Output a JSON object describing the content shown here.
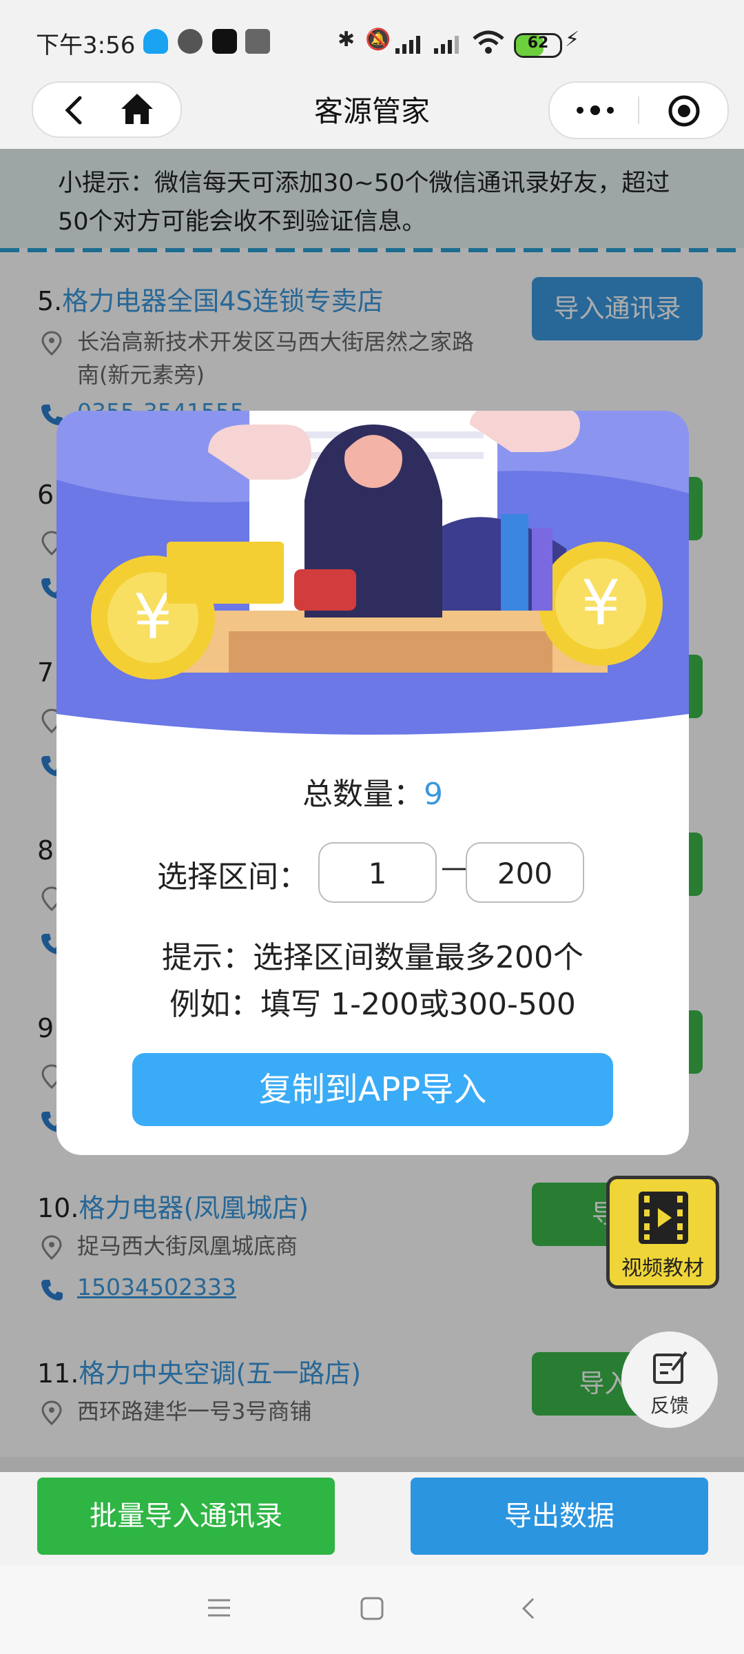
{
  "status": {
    "time": "下午3:56",
    "battery": "62"
  },
  "nav": {
    "title": "客源管家"
  },
  "tip": {
    "text": "小提示：微信每天可添加30~50个微信通讯录好友，超过50个对方可能会收不到验证信息。"
  },
  "list": [
    {
      "num": "5.",
      "name": "格力电器全国4S连锁专卖店",
      "address": "长治高新技术开发区马西大街居然之家路南(新元素旁)",
      "phone": "0355-3541555",
      "button": "导入通讯录"
    },
    {
      "num": "6.",
      "name": "",
      "address": "",
      "phone": "",
      "button": ""
    },
    {
      "num": "7.",
      "name": "",
      "address": "",
      "phone": "",
      "button": ""
    },
    {
      "num": "8.",
      "name": "",
      "address": "",
      "phone": "",
      "button": ""
    },
    {
      "num": "9.",
      "name": "",
      "address": "",
      "phone": "",
      "button": ""
    },
    {
      "num": "10.",
      "name": "格力电器(凤凰城店)",
      "address": "捉马西大街凤凰城底商",
      "phone": "15034502333",
      "button": "导入"
    },
    {
      "num": "11.",
      "name": "格力中央空调(五一路店)",
      "address": "西环路建华一号3号商铺",
      "phone": "",
      "button": "导入微"
    }
  ],
  "modal": {
    "total_label": "总数量：",
    "total_value": "9",
    "range_label": "选择区间：",
    "range_from": "1",
    "range_sep": "—",
    "range_to": "200",
    "hint_line1": "提示：选择区间数量最多200个",
    "hint_line2": "例如：填写 1-200或300-500",
    "copy_button": "复制到APP导入"
  },
  "bottom": {
    "batch_button": "批量导入通讯录",
    "export_button": "导出数据"
  },
  "floating": {
    "video_label": "视频教材",
    "feedback_label": "反馈"
  },
  "colors": {
    "accent_blue": "#3a98dd",
    "green": "#3cb84a",
    "video_yellow": "#efd537"
  }
}
